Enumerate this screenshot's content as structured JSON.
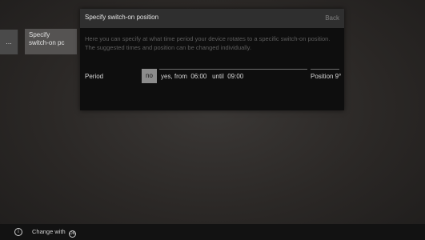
{
  "background_menu": {
    "ellipsis": "...",
    "item_label_line1": "Specify",
    "item_label_line2": "switch-on pc"
  },
  "dialog": {
    "title": "Specify switch-on position",
    "back_label": "Back",
    "description": "Here you can specify at what time period your device rotates to a specific switch-on position. The suggested times and position can be changed individually.",
    "period_label": "Period",
    "option_no": "no",
    "option_yes_prefix": "yes, from",
    "from_time": "06:00",
    "until_label": "until",
    "until_time": "09:00",
    "position_label": "Position 9°"
  },
  "footer": {
    "info_icon": "i",
    "hint_text": "Change with",
    "ok_icon": "OK"
  },
  "colors": {
    "dialog_background": "#0e0e0e",
    "dialog_header": "#2f2f2f",
    "selected_option": "#8c8c8c",
    "footer_background": "#121212"
  }
}
